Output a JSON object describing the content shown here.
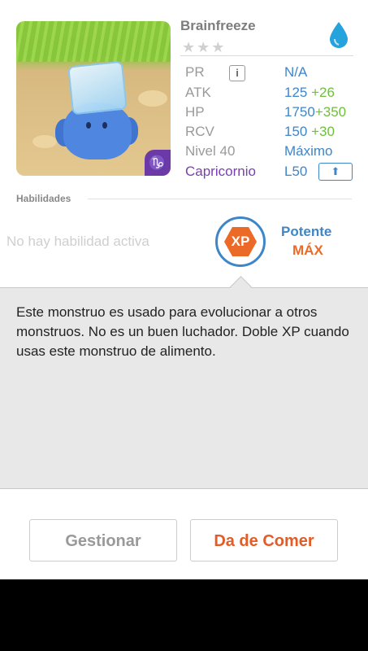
{
  "monster": {
    "name": "Brainfreeze",
    "stars": "★★★",
    "rarity_stars_filled": 0,
    "rarity_stars_total": 3,
    "sign_badge_text": "♑"
  },
  "stats": {
    "pr": {
      "label": "PR",
      "value": "N/A"
    },
    "atk": {
      "label": "ATK",
      "value": "125",
      "bonus": "+26"
    },
    "hp": {
      "label": "HP",
      "value": "1750",
      "bonus": "+350"
    },
    "rcv": {
      "label": "RCV",
      "value": "150",
      "bonus": "+30"
    },
    "level": {
      "label": "Nivel 40",
      "value": "Máximo"
    },
    "zodiac": {
      "label": "Capricornio",
      "value": "L50"
    }
  },
  "abilities": {
    "title": "Habilidades",
    "empty_text": "No hay habilidad activa",
    "badge_text": "XP",
    "badge_title": "Potente",
    "badge_level": "MÁX"
  },
  "description": "Este monstruo es usado para evolucionar a otros monstruos. No es un buen luchador. Doble XP cuando usas este monstruo de alimento.",
  "buttons": {
    "manage": "Gestionar",
    "feed": "Da de Comer"
  },
  "colors": {
    "accent_blue": "#3f86c9",
    "bonus_green": "#6ebf3c",
    "orange": "#ec6a27",
    "zodiac_purple": "#7a3fb0"
  },
  "icons": {
    "element": "water-drop-icon",
    "info": "info-icon",
    "upgrade": "arrow-up-icon"
  }
}
